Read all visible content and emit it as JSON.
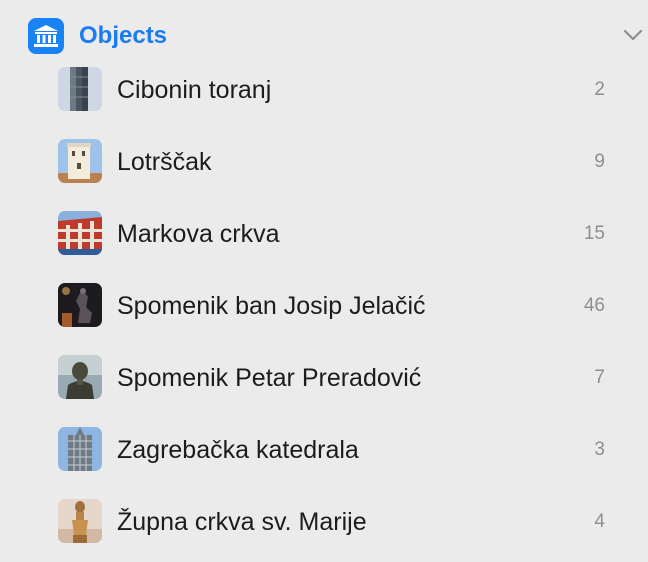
{
  "section": {
    "title": "Objects",
    "icon": "museum-icon",
    "accent_color": "#1a82f7",
    "collapse_icon": "chevron-down-icon"
  },
  "items": [
    {
      "label": "Cibonin toranj",
      "count": "2",
      "thumbnail": "tower-photo"
    },
    {
      "label": "Lotrščak",
      "count": "9",
      "thumbnail": "tower-photo"
    },
    {
      "label": "Markova crkva",
      "count": "15",
      "thumbnail": "church-roof-photo"
    },
    {
      "label": "Spomenik ban Josip Jelačić",
      "count": "46",
      "thumbnail": "statue-photo"
    },
    {
      "label": "Spomenik Petar Preradović",
      "count": "7",
      "thumbnail": "statue-photo"
    },
    {
      "label": "Zagrebačka katedrala",
      "count": "3",
      "thumbnail": "cathedral-photo"
    },
    {
      "label": "Župna crkva sv. Marije",
      "count": "4",
      "thumbnail": "statue-photo"
    }
  ]
}
